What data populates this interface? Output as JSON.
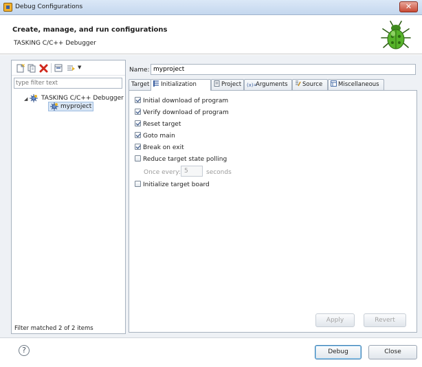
{
  "window": {
    "title": "Debug Configurations",
    "close_glyph": "✕"
  },
  "header": {
    "title": "Create, manage, and run configurations",
    "subtitle": "TASKING C/C++ Debugger",
    "icon": "bug-icon"
  },
  "left_pane": {
    "toolbar_icons": [
      "new-configuration-icon",
      "duplicate-icon",
      "delete-icon",
      "collapse-all-icon",
      "filter-icon",
      "dropdown-arrow-icon"
    ],
    "filter_placeholder": "type filter text",
    "tree": {
      "parent_label": "TASKING C/C++ Debugger",
      "child_label": "myproject"
    },
    "status": "Filter matched 2 of 2 items"
  },
  "config": {
    "name_label": "Name:",
    "name_value": "myproject",
    "tabs": [
      {
        "label": "Target",
        "icon": ""
      },
      {
        "label": "Initialization",
        "icon": "initialization-icon"
      },
      {
        "label": "Project",
        "icon": "project-icon"
      },
      {
        "label": "Arguments",
        "icon": "arguments-icon"
      },
      {
        "label": "Source",
        "icon": "source-icon"
      },
      {
        "label": "Miscellaneous",
        "icon": "miscellaneous-icon"
      }
    ],
    "active_tab": "Initialization",
    "options": [
      {
        "label": "Initial download of program",
        "checked": true
      },
      {
        "label": "Verify download of program",
        "checked": true
      },
      {
        "label": "Reset target",
        "checked": true
      },
      {
        "label": "Goto main",
        "checked": true
      },
      {
        "label": "Break on exit",
        "checked": true
      },
      {
        "label": "Reduce target state polling",
        "checked": false
      },
      {
        "label": "Initialize target board",
        "checked": false
      }
    ],
    "polling": {
      "label": "Once every:",
      "value": "5",
      "unit": "seconds"
    },
    "apply_label": "Apply",
    "revert_label": "Revert"
  },
  "footer": {
    "help_glyph": "?",
    "debug_label": "Debug",
    "close_label": "Close"
  },
  "colors": {
    "title_bar": "#c4d7ee",
    "selection": "#d9e6f5",
    "delete_icon": "#d0281c",
    "bug": "#56b32a"
  }
}
